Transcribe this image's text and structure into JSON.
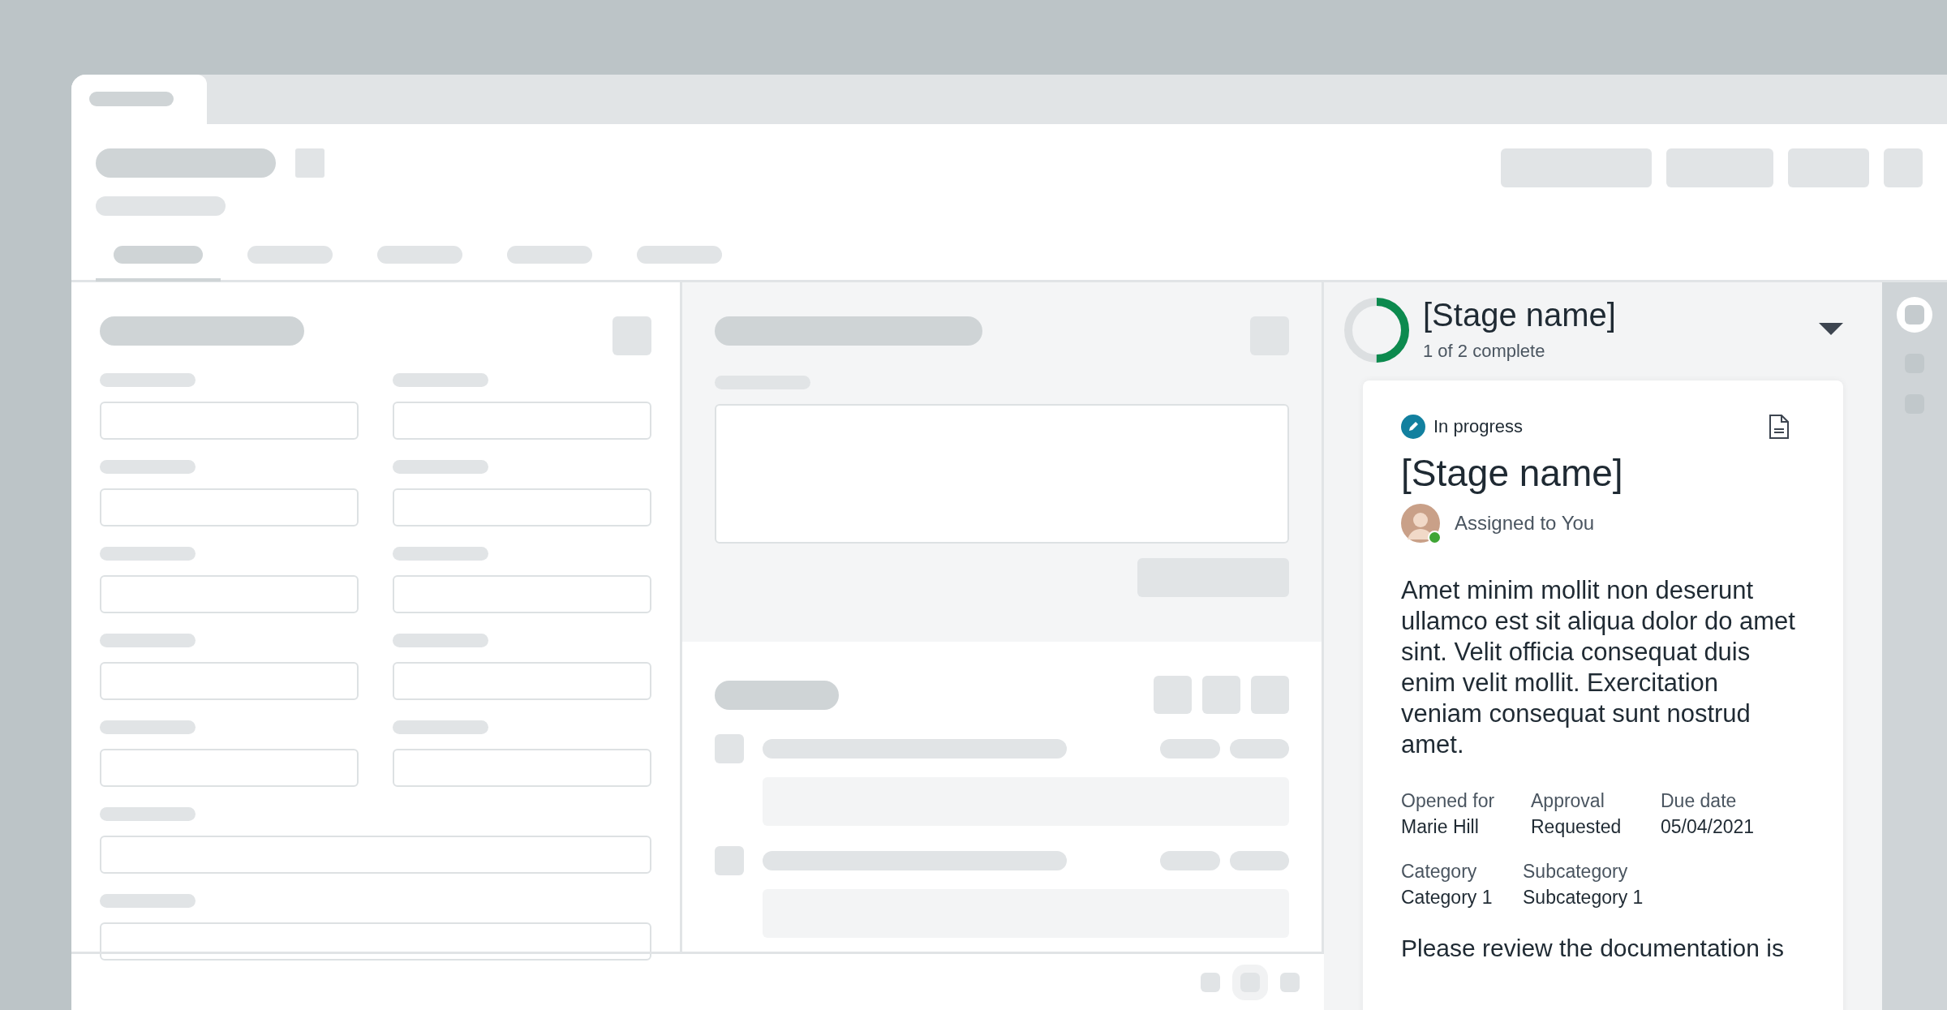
{
  "tabs": [
    {
      "selected": true
    },
    {
      "selected": false
    },
    {
      "selected": false
    },
    {
      "selected": false
    },
    {
      "selected": false
    }
  ],
  "stage_header": {
    "title": "[Stage name]",
    "subtitle": "1 of 2 complete",
    "level": 0.5
  },
  "stage_card": {
    "status": "In progress",
    "title": "[Stage name]",
    "assignee": {
      "label": "Assigned to You",
      "online": true
    },
    "description": "Amet minim mollit non deserunt ullamco est sit aliqua dolor do amet sint. Velit officia consequat duis enim velit mollit. Exercitation veniam consequat sunt nostrud amet.",
    "field_rows": [
      [
        {
          "label": "Opened for",
          "value": "Marie Hill"
        },
        {
          "label": "Approval",
          "value": "Requested"
        },
        {
          "label": "Due date",
          "value": "05/04/2021"
        }
      ],
      [
        {
          "label": "Category",
          "value": "Category 1"
        },
        {
          "label": "Subcategory",
          "value": "Subcategory 1"
        }
      ]
    ],
    "note": "Please review the documentation is"
  }
}
